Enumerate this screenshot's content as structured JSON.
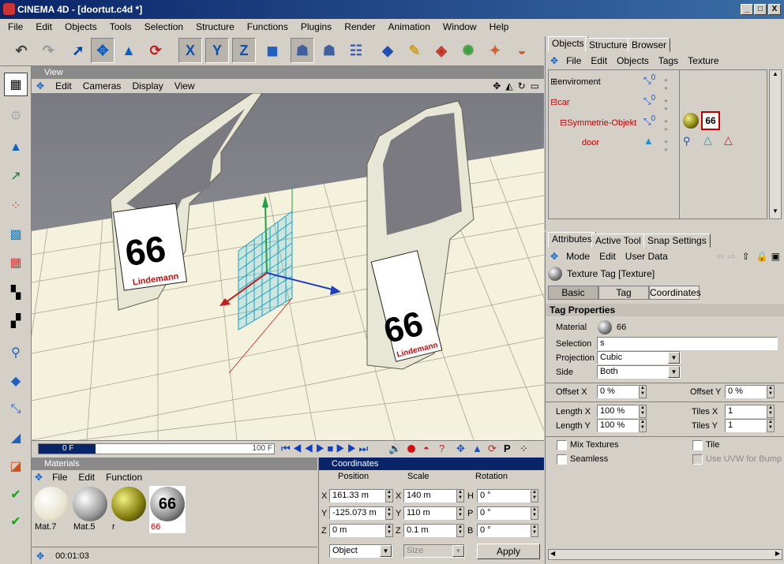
{
  "window": {
    "title": "CINEMA 4D - [doortut.c4d *]",
    "min": "_",
    "max": "□",
    "close": "X"
  },
  "menu": [
    "File",
    "Edit",
    "Objects",
    "Tools",
    "Selection",
    "Structure",
    "Functions",
    "Plugins",
    "Render",
    "Animation",
    "Window",
    "Help"
  ],
  "toolbar": {
    "x_label": "X",
    "y_label": "Y",
    "z_label": "Z"
  },
  "view": {
    "title": "View",
    "menu": [
      "Edit",
      "Cameras",
      "Display",
      "View"
    ]
  },
  "timeline": {
    "start": "0 F",
    "end": "100 F"
  },
  "materials": {
    "title": "Materials",
    "menu": [
      "File",
      "Edit",
      "Function"
    ],
    "items": [
      {
        "name": "Mat.7",
        "color": "#f4f0e4"
      },
      {
        "name": "Mat.5",
        "color": "#b0b0b0"
      },
      {
        "name": "r",
        "color": "#8a8414"
      },
      {
        "name": "66",
        "color": "#404040"
      }
    ],
    "time": "00:01:03"
  },
  "coordinates": {
    "title": "Coordinates",
    "headers": [
      "Position",
      "Scale",
      "Rotation"
    ],
    "rows": [
      {
        "pl": "X",
        "pv": "161.33 m",
        "sl": "X",
        "sv": "140 m",
        "rl": "H",
        "rv": "0 °"
      },
      {
        "pl": "Y",
        "pv": "-125.073 m",
        "sl": "Y",
        "sv": "110 m",
        "rl": "P",
        "rv": "0 °"
      },
      {
        "pl": "Z",
        "pv": "0 m",
        "sl": "Z",
        "sv": "0.1 m",
        "rl": "B",
        "rv": "0 °"
      }
    ],
    "mode": "Object",
    "size": "Size",
    "apply": "Apply"
  },
  "objects": {
    "tabs": [
      "Objects",
      "Structure",
      "Browser"
    ],
    "menu": [
      "File",
      "Edit",
      "Objects",
      "Tags",
      "Texture"
    ],
    "tree": [
      {
        "name": "enviroment",
        "color": "#000"
      },
      {
        "name": "car",
        "color": "#c00000"
      },
      {
        "name": "Symmetrie-Objekt",
        "color": "#c00000"
      },
      {
        "name": "door",
        "color": "#c00000"
      }
    ],
    "layer_digit": "0"
  },
  "attributes": {
    "tabs": [
      "Attributes",
      "Active Tool",
      "Snap Settings"
    ],
    "menu": [
      "Mode",
      "Edit",
      "User Data"
    ],
    "title": "Texture Tag [Texture]",
    "subtabs": [
      "Basic",
      "Tag",
      "Coordinates"
    ],
    "section": "Tag Properties",
    "material_label": "Material",
    "material_value": "66",
    "selection_label": "Selection",
    "selection_value": "s",
    "projection_label": "Projection",
    "projection_value": "Cubic",
    "side_label": "Side",
    "side_value": "Both",
    "offsetx_label": "Offset X",
    "offsetx_value": "0 %",
    "offsety_label": "Offset Y",
    "offsety_value": "0 %",
    "lengthx_label": "Length X",
    "lengthx_value": "100 %",
    "tilesx_label": "Tiles X",
    "tilesx_value": "1",
    "lengthy_label": "Length Y",
    "lengthy_value": "100 %",
    "tilesy_label": "Tiles Y",
    "tilesy_value": "1",
    "mix_label": "Mix Textures",
    "tile_label": "Tile",
    "seamless_label": "Seamless",
    "uvw_label": "Use UVW for Bump"
  },
  "decals": {
    "number": "66",
    "sponsor": "Lindemann"
  }
}
